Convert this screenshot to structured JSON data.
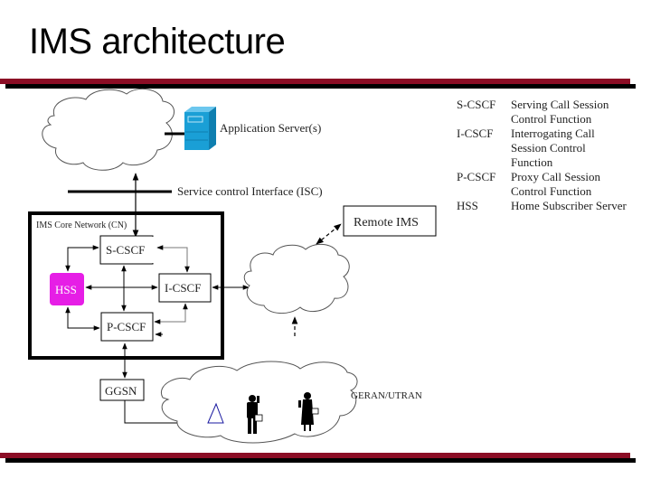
{
  "slide": {
    "title": "IMS architecture"
  },
  "diagram": {
    "application_server_label": "Application Server(s)",
    "isc_label": "Service control Interface (ISC)",
    "core_network_label": "IMS Core Network (CN)",
    "nodes": {
      "s_cscf": "S-CSCF",
      "i_cscf": "I-CSCF",
      "p_cscf": "P-CSCF",
      "hss": "HSS",
      "remote_ims": "Remote IMS",
      "ggsn": "GGSN"
    },
    "access_network_label": "GERAN/UTRAN",
    "colors": {
      "hss_fill": "#e61ee6",
      "server_fill": "#1a9fd6",
      "rule_red": "#8b0d25"
    }
  },
  "legend": [
    {
      "abbr": "S-CSCF",
      "definition": "Serving Call Session Control Function"
    },
    {
      "abbr": "I-CSCF",
      "definition": "Interrogating Call Session Control Function"
    },
    {
      "abbr": "P-CSCF",
      "definition": "Proxy Call Session Control Function"
    },
    {
      "abbr": "HSS",
      "definition": "Home Subscriber Server"
    }
  ]
}
